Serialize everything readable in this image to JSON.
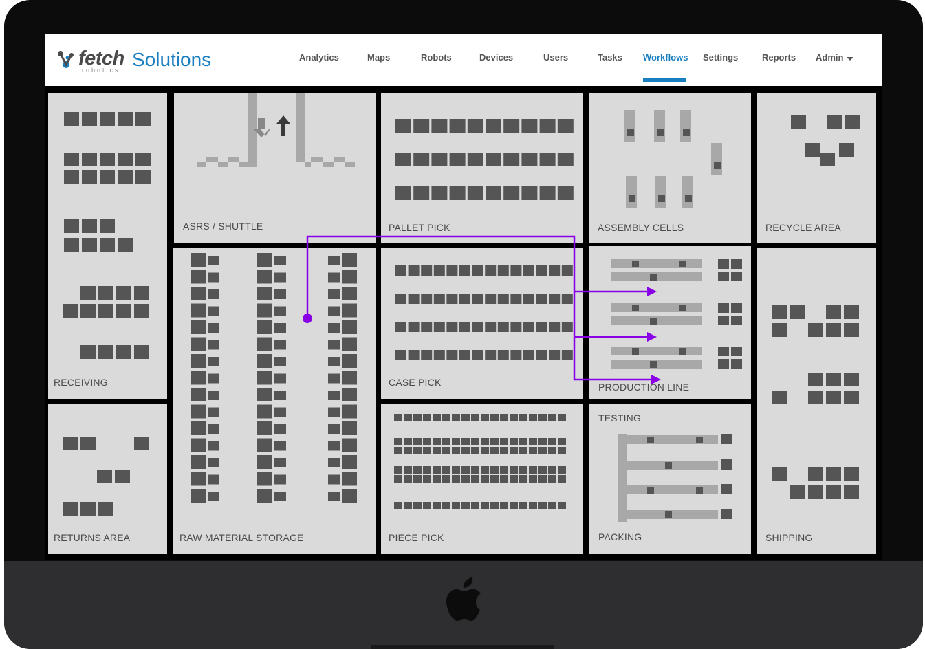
{
  "header": {
    "logo_text": "fetch",
    "logo_subtext": "robotics",
    "app_title": "Solutions"
  },
  "nav": {
    "items": [
      {
        "label": "Analytics"
      },
      {
        "label": "Maps"
      },
      {
        "label": "Robots"
      },
      {
        "label": "Devices"
      },
      {
        "label": "Users"
      },
      {
        "label": "Tasks"
      },
      {
        "label": "Workflows",
        "active": true
      },
      {
        "label": "Settings"
      },
      {
        "label": "Reports"
      },
      {
        "label": "Admin",
        "dropdown": true
      }
    ]
  },
  "zones": {
    "receiving": "RECEIVING",
    "returns": "RETURNS AREA",
    "asrs": "ASRS / SHUTTLE",
    "raw_material": "RAW MATERIAL STORAGE",
    "pallet_pick": "PALLET PICK",
    "case_pick": "CASE PICK",
    "piece_pick": "PIECE PICK",
    "assembly": "ASSEMBLY CELLS",
    "production": "PRODUCTION LINE",
    "testing": "TESTING",
    "packing": "PACKING",
    "recycle": "RECYCLE AREA",
    "shipping": "SHIPPING"
  },
  "colors": {
    "brand_blue": "#1a7fc1",
    "zone_fill": "#dadada",
    "block_dark": "#555555",
    "block_light": "#a8a8a8",
    "workflow_purple": "#8a00e6",
    "monitor_bezel": "#0c0c0c",
    "monitor_chin": "#2e2e30"
  },
  "icons": {
    "apple_logo": "apple-logo-icon",
    "dropdown": "caret-down-icon"
  }
}
